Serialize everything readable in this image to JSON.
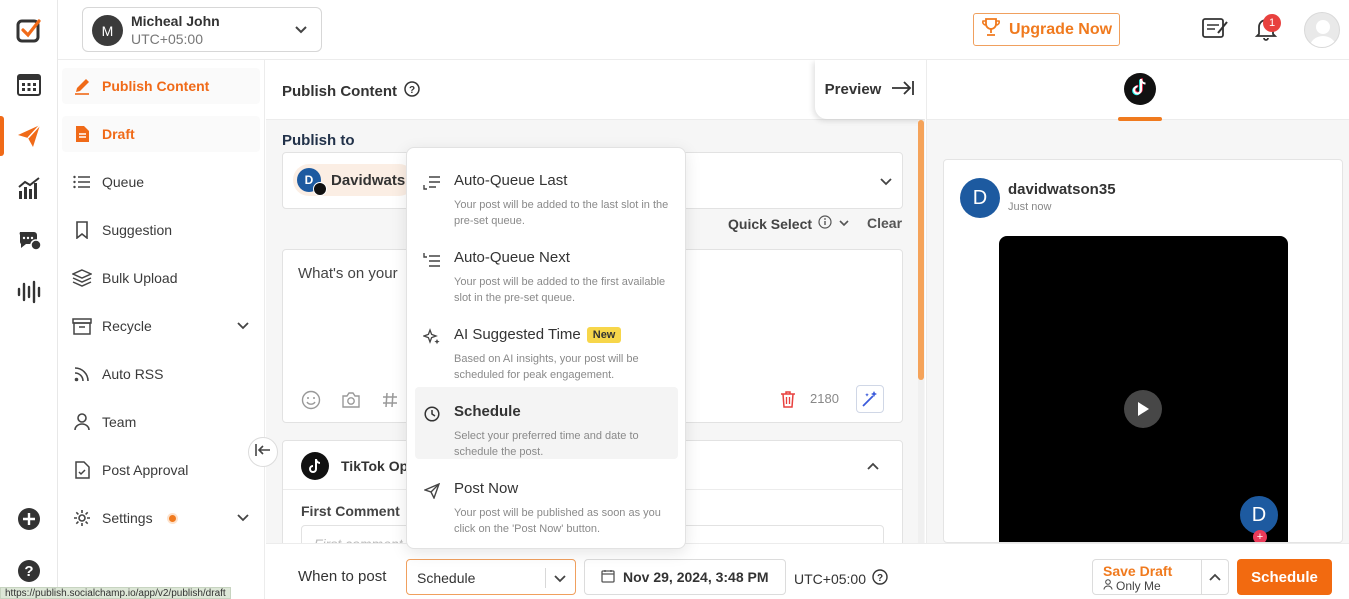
{
  "topbar": {
    "account_name": "Micheal John",
    "account_tz": "UTC+05:00",
    "account_initial": "M",
    "upgrade_label": "Upgrade Now",
    "notification_count": "1"
  },
  "rail": {
    "icons": [
      "logo-icon",
      "calendar-icon",
      "publish-icon",
      "analytics-icon",
      "engage-icon",
      "listening-icon",
      "add-icon",
      "help-icon"
    ]
  },
  "sidebar": {
    "items": [
      {
        "label": "Publish Content"
      },
      {
        "label": "Draft"
      },
      {
        "label": "Queue"
      },
      {
        "label": "Suggestion"
      },
      {
        "label": "Bulk Upload"
      },
      {
        "label": "Recycle"
      },
      {
        "label": "Auto RSS"
      },
      {
        "label": "Team"
      },
      {
        "label": "Post Approval"
      },
      {
        "label": "Settings"
      }
    ]
  },
  "main": {
    "title": "Publish Content",
    "preview_label": "Preview",
    "publish_to_label": "Publish to",
    "selected_account": "Davidwats",
    "account_initial": "D",
    "quick_select_label": "Quick Select",
    "clear_label": "Clear",
    "editor_placeholder": "What's on your",
    "char_count": "2180",
    "tiktok_options_title": "TikTok Op",
    "first_comment_label": "First Comment",
    "first_comment_placeholder": "First comment"
  },
  "dropdown": {
    "items": [
      {
        "title": "Auto-Queue Last",
        "desc": "Your post will be added to the last slot in the pre-set queue."
      },
      {
        "title": "Auto-Queue Next",
        "desc": "Your post will be added to the first available slot in the pre-set queue."
      },
      {
        "title": "AI Suggested Time",
        "badge": "New",
        "desc": "Based on AI insights, your post will be scheduled for peak engagement."
      },
      {
        "title": "Schedule",
        "desc": "Select your preferred time and date to schedule the post."
      },
      {
        "title": "Post Now",
        "desc": "Your post will be published as soon as you click on the 'Post Now' button."
      }
    ]
  },
  "footer": {
    "when_label": "When to post",
    "schedule_value": "Schedule",
    "date_value": "Nov 29, 2024, 3:48 PM",
    "timezone": "UTC+05:00",
    "save_draft_label": "Save Draft",
    "save_draft_sub": "Only Me",
    "schedule_button": "Schedule"
  },
  "preview": {
    "username": "davidwatson35",
    "time": "Just now",
    "initial": "D"
  },
  "status_url": "https://publish.socialchamp.io/app/v2/publish/draft",
  "colors": {
    "accent": "#f06a18",
    "tiktok": "#111111",
    "avatar_blue": "#1d5aa0",
    "new_badge": "#f7d64a"
  }
}
